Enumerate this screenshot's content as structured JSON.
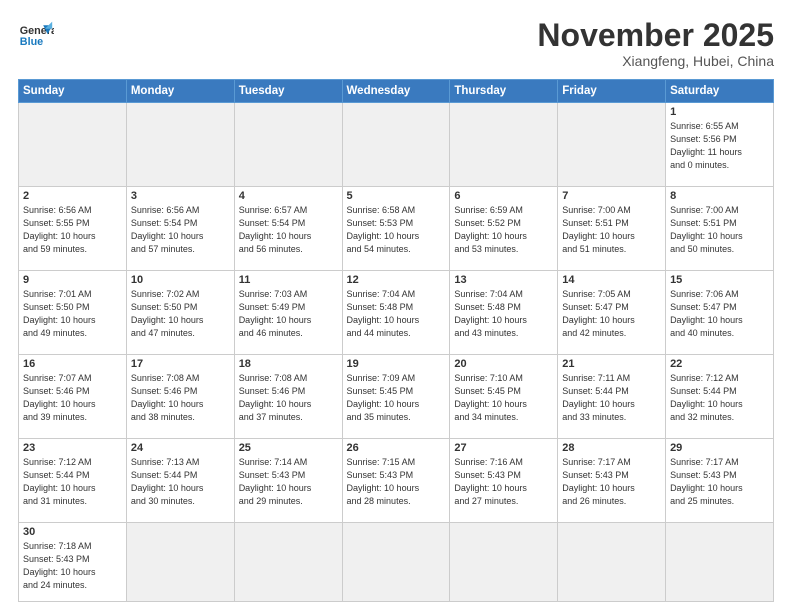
{
  "header": {
    "logo_general": "General",
    "logo_blue": "Blue",
    "month_title": "November 2025",
    "subtitle": "Xiangfeng, Hubei, China"
  },
  "weekdays": [
    "Sunday",
    "Monday",
    "Tuesday",
    "Wednesday",
    "Thursday",
    "Friday",
    "Saturday"
  ],
  "weeks": [
    [
      {
        "day": "",
        "info": "",
        "empty": true
      },
      {
        "day": "",
        "info": "",
        "empty": true
      },
      {
        "day": "",
        "info": "",
        "empty": true
      },
      {
        "day": "",
        "info": "",
        "empty": true
      },
      {
        "day": "",
        "info": "",
        "empty": true
      },
      {
        "day": "",
        "info": "",
        "empty": true
      },
      {
        "day": "1",
        "info": "Sunrise: 6:55 AM\nSunset: 5:56 PM\nDaylight: 11 hours\nand 0 minutes.",
        "empty": false
      }
    ],
    [
      {
        "day": "2",
        "info": "Sunrise: 6:56 AM\nSunset: 5:55 PM\nDaylight: 10 hours\nand 59 minutes.",
        "empty": false
      },
      {
        "day": "3",
        "info": "Sunrise: 6:56 AM\nSunset: 5:54 PM\nDaylight: 10 hours\nand 57 minutes.",
        "empty": false
      },
      {
        "day": "4",
        "info": "Sunrise: 6:57 AM\nSunset: 5:54 PM\nDaylight: 10 hours\nand 56 minutes.",
        "empty": false
      },
      {
        "day": "5",
        "info": "Sunrise: 6:58 AM\nSunset: 5:53 PM\nDaylight: 10 hours\nand 54 minutes.",
        "empty": false
      },
      {
        "day": "6",
        "info": "Sunrise: 6:59 AM\nSunset: 5:52 PM\nDaylight: 10 hours\nand 53 minutes.",
        "empty": false
      },
      {
        "day": "7",
        "info": "Sunrise: 7:00 AM\nSunset: 5:51 PM\nDaylight: 10 hours\nand 51 minutes.",
        "empty": false
      },
      {
        "day": "8",
        "info": "Sunrise: 7:00 AM\nSunset: 5:51 PM\nDaylight: 10 hours\nand 50 minutes.",
        "empty": false
      }
    ],
    [
      {
        "day": "9",
        "info": "Sunrise: 7:01 AM\nSunset: 5:50 PM\nDaylight: 10 hours\nand 49 minutes.",
        "empty": false
      },
      {
        "day": "10",
        "info": "Sunrise: 7:02 AM\nSunset: 5:50 PM\nDaylight: 10 hours\nand 47 minutes.",
        "empty": false
      },
      {
        "day": "11",
        "info": "Sunrise: 7:03 AM\nSunset: 5:49 PM\nDaylight: 10 hours\nand 46 minutes.",
        "empty": false
      },
      {
        "day": "12",
        "info": "Sunrise: 7:04 AM\nSunset: 5:48 PM\nDaylight: 10 hours\nand 44 minutes.",
        "empty": false
      },
      {
        "day": "13",
        "info": "Sunrise: 7:04 AM\nSunset: 5:48 PM\nDaylight: 10 hours\nand 43 minutes.",
        "empty": false
      },
      {
        "day": "14",
        "info": "Sunrise: 7:05 AM\nSunset: 5:47 PM\nDaylight: 10 hours\nand 42 minutes.",
        "empty": false
      },
      {
        "day": "15",
        "info": "Sunrise: 7:06 AM\nSunset: 5:47 PM\nDaylight: 10 hours\nand 40 minutes.",
        "empty": false
      }
    ],
    [
      {
        "day": "16",
        "info": "Sunrise: 7:07 AM\nSunset: 5:46 PM\nDaylight: 10 hours\nand 39 minutes.",
        "empty": false
      },
      {
        "day": "17",
        "info": "Sunrise: 7:08 AM\nSunset: 5:46 PM\nDaylight: 10 hours\nand 38 minutes.",
        "empty": false
      },
      {
        "day": "18",
        "info": "Sunrise: 7:08 AM\nSunset: 5:46 PM\nDaylight: 10 hours\nand 37 minutes.",
        "empty": false
      },
      {
        "day": "19",
        "info": "Sunrise: 7:09 AM\nSunset: 5:45 PM\nDaylight: 10 hours\nand 35 minutes.",
        "empty": false
      },
      {
        "day": "20",
        "info": "Sunrise: 7:10 AM\nSunset: 5:45 PM\nDaylight: 10 hours\nand 34 minutes.",
        "empty": false
      },
      {
        "day": "21",
        "info": "Sunrise: 7:11 AM\nSunset: 5:44 PM\nDaylight: 10 hours\nand 33 minutes.",
        "empty": false
      },
      {
        "day": "22",
        "info": "Sunrise: 7:12 AM\nSunset: 5:44 PM\nDaylight: 10 hours\nand 32 minutes.",
        "empty": false
      }
    ],
    [
      {
        "day": "23",
        "info": "Sunrise: 7:12 AM\nSunset: 5:44 PM\nDaylight: 10 hours\nand 31 minutes.",
        "empty": false
      },
      {
        "day": "24",
        "info": "Sunrise: 7:13 AM\nSunset: 5:44 PM\nDaylight: 10 hours\nand 30 minutes.",
        "empty": false
      },
      {
        "day": "25",
        "info": "Sunrise: 7:14 AM\nSunset: 5:43 PM\nDaylight: 10 hours\nand 29 minutes.",
        "empty": false
      },
      {
        "day": "26",
        "info": "Sunrise: 7:15 AM\nSunset: 5:43 PM\nDaylight: 10 hours\nand 28 minutes.",
        "empty": false
      },
      {
        "day": "27",
        "info": "Sunrise: 7:16 AM\nSunset: 5:43 PM\nDaylight: 10 hours\nand 27 minutes.",
        "empty": false
      },
      {
        "day": "28",
        "info": "Sunrise: 7:17 AM\nSunset: 5:43 PM\nDaylight: 10 hours\nand 26 minutes.",
        "empty": false
      },
      {
        "day": "29",
        "info": "Sunrise: 7:17 AM\nSunset: 5:43 PM\nDaylight: 10 hours\nand 25 minutes.",
        "empty": false
      }
    ],
    [
      {
        "day": "30",
        "info": "Sunrise: 7:18 AM\nSunset: 5:43 PM\nDaylight: 10 hours\nand 24 minutes.",
        "empty": false
      },
      {
        "day": "",
        "info": "",
        "empty": true
      },
      {
        "day": "",
        "info": "",
        "empty": true
      },
      {
        "day": "",
        "info": "",
        "empty": true
      },
      {
        "day": "",
        "info": "",
        "empty": true
      },
      {
        "day": "",
        "info": "",
        "empty": true
      },
      {
        "day": "",
        "info": "",
        "empty": true
      }
    ]
  ]
}
